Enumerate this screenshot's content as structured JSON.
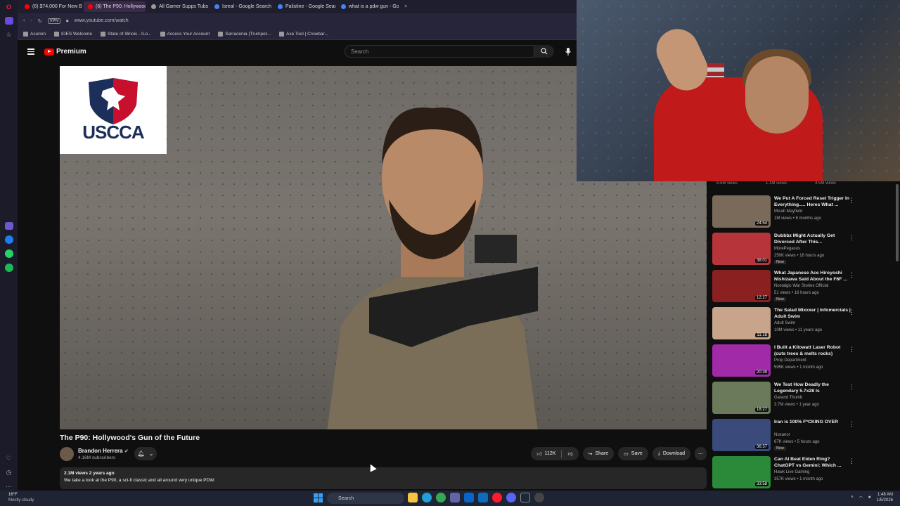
{
  "browser": {
    "tabs": [
      {
        "label": "(6) $74,000 For New Booi",
        "favicon_color": "#ff0000"
      },
      {
        "label": "(6) The P90: Hollywood's",
        "favicon_color": "#ff0000",
        "active": true
      },
      {
        "label": "All Gamer Supps Tubs",
        "favicon_color": "#999999"
      },
      {
        "label": "Isreal - Google Search",
        "favicon_color": "#4285f4"
      },
      {
        "label": "Palistine - Google Searc",
        "favicon_color": "#4285f4"
      },
      {
        "label": "what is a pdw gun - Goog",
        "favicon_color": "#4285f4"
      }
    ],
    "new_tab": "+",
    "vpn_label": "VPN",
    "url": "www.youtube.com/watch",
    "bookmarks": [
      "Asurion",
      "IDES Welcome",
      "State of Illinois - ILo...",
      "Access Your Account",
      "Sarracenia (Trumpet...",
      "Axe Tool | Crowbar..."
    ]
  },
  "youtube": {
    "logo_text": "Premium",
    "search_placeholder": "Search",
    "video": {
      "sponsor_logo": "USCCA",
      "title": "The P90: Hollywood's Gun of the Future",
      "channel": "Brandon Herrera",
      "subscribers": "4.16M subscribers",
      "likes": "112K",
      "share_label": "Share",
      "save_label": "Save",
      "download_label": "Download",
      "views_age": "2.1M views  2 years ago",
      "description": "We take a look at the P90, a sci-fi classic and all around very unique PDW."
    },
    "recs_header": [
      "8.5M views",
      "1.1M views",
      "4.5M views"
    ],
    "recommendations": [
      {
        "title": "We Put A Forced Reset Trigger In Everything..... Heres What ...",
        "channel": "Micah Mayfield",
        "meta": "1M views • 8 months ago",
        "duration": "24:54",
        "new": "",
        "thumb": "#7a6a5a"
      },
      {
        "title": "Dubbbz Might Actually Get Divorced After This...",
        "channel": "MorePegasus",
        "meta": "250K views • 16 hours ago",
        "duration": "38:01",
        "new": "New",
        "thumb": "#b7343a"
      },
      {
        "title": "What Japanese Ace Hiroyoshi Nishizawa Said About the F6F ...",
        "channel": "Nostalgic War Stories Official",
        "meta": "51 views • 16 hours ago",
        "duration": "12:27",
        "new": "New",
        "thumb": "#8a2020"
      },
      {
        "title": "The Salad Mixxxer | Infomercials | Adult Swim",
        "channel": "Adult Swim",
        "meta": "10M views • 11 years ago",
        "duration": "11:18",
        "new": "",
        "thumb": "#c8a58a"
      },
      {
        "title": "I Built a Kilowatt Laser Robot (cuts trees & melts rocks)",
        "channel": "Prop Department",
        "meta": "595K views • 1 month ago",
        "duration": "20:39",
        "new": "",
        "thumb": "#a02aa8"
      },
      {
        "title": "We Test How Deadly the Legendary 5.7x28 Is",
        "channel": "Garand Thumb",
        "meta": "3.7M views • 1 year ago",
        "duration": "18:27",
        "new": "",
        "thumb": "#6a7a5a"
      },
      {
        "title": "Iran is 100% F*CKING OVER",
        "channel": "Nuxanor",
        "meta": "67K views • 5 hours ago",
        "duration": "36:37",
        "new": "New",
        "thumb": "#3a4a7a"
      },
      {
        "title": "Can AI Beat Elden Ring? ChatGPT vs Gemini: Which ...",
        "channel": "Hawk Live Gaming",
        "meta": "357K views • 1 month ago",
        "duration": "33:58",
        "new": "",
        "thumb": "#2a8a3a"
      }
    ]
  },
  "taskbar": {
    "temp": "16°F",
    "weather": "Mostly cloudy",
    "search_label": "Search",
    "time": "1:48 AM",
    "date": "1/5/2026"
  }
}
